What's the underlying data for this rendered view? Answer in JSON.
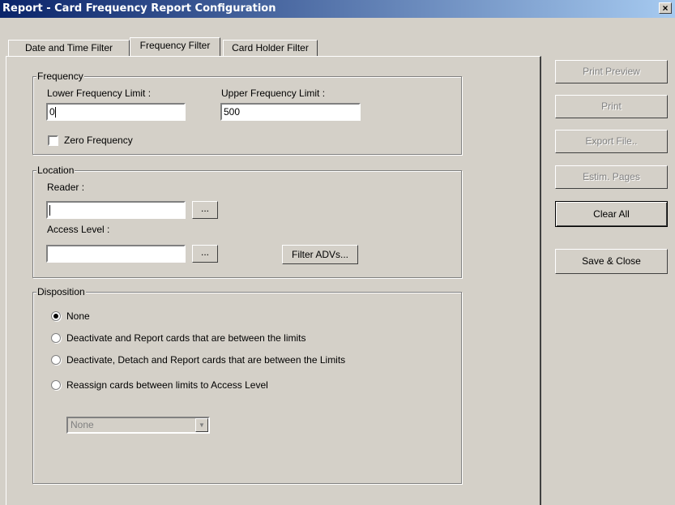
{
  "window": {
    "title": "Report  - Card Frequency Report Configuration",
    "close_icon": "×"
  },
  "tabs": [
    {
      "label": "Date and Time Filter"
    },
    {
      "label": "Frequency Filter",
      "active": true
    },
    {
      "label": "Card Holder Filter"
    }
  ],
  "frequency": {
    "group_label": "Frequency",
    "lower_label": "Lower Frequency Limit :",
    "lower_value": "0",
    "upper_label": "Upper Frequency Limit :",
    "upper_value": "500",
    "zero_label": "Zero Frequency",
    "zero_checked": false
  },
  "location": {
    "group_label": "Location",
    "reader_label": "Reader :",
    "reader_value": "",
    "access_label": "Access Level :",
    "access_value": "",
    "browse_label": "...",
    "filter_label": "Filter ADVs..."
  },
  "disposition": {
    "group_label": "Disposition",
    "options": [
      {
        "label": "None",
        "selected": true
      },
      {
        "label": "Deactivate and Report cards that are between the limits",
        "selected": false
      },
      {
        "label": "Deactivate, Detach and Report cards that are between the Limits",
        "selected": false
      },
      {
        "label": "Reassign cards between limits to Access Level",
        "selected": false
      }
    ],
    "access_level_select": "None",
    "dropdown_icon": "▼"
  },
  "side_buttons": {
    "print_preview": "Print Preview",
    "print": "Print",
    "export_file": "Export File..",
    "estim_pages": "Estim. Pages",
    "clear_all": "Clear All",
    "save_close": "Save & Close"
  },
  "colors": {
    "face": "#d4d0c8",
    "title_start": "#0a246a",
    "title_end": "#a6caf0",
    "disabled_text": "#808080"
  }
}
